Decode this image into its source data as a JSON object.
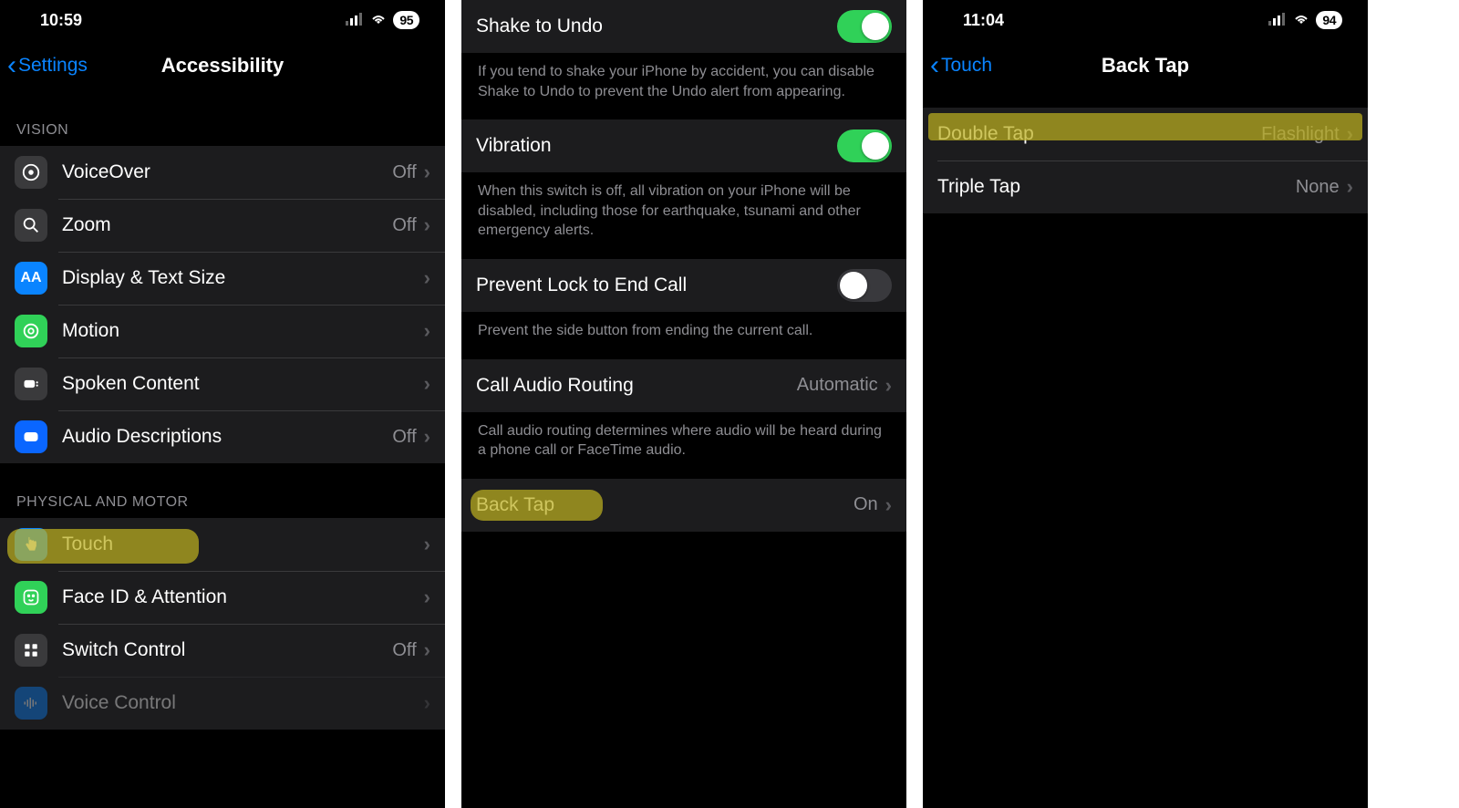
{
  "phone1": {
    "status": {
      "time": "10:59",
      "battery": "95"
    },
    "nav": {
      "back": "Settings",
      "title": "Accessibility"
    },
    "sections": {
      "vision": {
        "header": "VISION",
        "items": [
          {
            "label": "VoiceOver",
            "value": "Off"
          },
          {
            "label": "Zoom",
            "value": "Off"
          },
          {
            "label": "Display & Text Size",
            "value": ""
          },
          {
            "label": "Motion",
            "value": ""
          },
          {
            "label": "Spoken Content",
            "value": ""
          },
          {
            "label": "Audio Descriptions",
            "value": "Off"
          }
        ]
      },
      "physical": {
        "header": "PHYSICAL AND MOTOR",
        "items": [
          {
            "label": "Touch",
            "value": ""
          },
          {
            "label": "Face ID & Attention",
            "value": ""
          },
          {
            "label": "Switch Control",
            "value": "Off"
          },
          {
            "label": "Voice Control",
            "value": ""
          }
        ]
      }
    }
  },
  "phone2": {
    "rows": {
      "shake": {
        "label": "Shake to Undo",
        "footer": "If you tend to shake your iPhone by accident, you can disable Shake to Undo to prevent the Undo alert from appearing."
      },
      "vibration": {
        "label": "Vibration",
        "footer": "When this switch is off, all vibration on your iPhone will be disabled, including those for earthquake, tsunami and other emergency alerts."
      },
      "prevent": {
        "label": "Prevent Lock to End Call",
        "footer": "Prevent the side button from ending the current call."
      },
      "routing": {
        "label": "Call Audio Routing",
        "value": "Automatic",
        "footer": "Call audio routing determines where audio will be heard during a phone call or FaceTime audio."
      },
      "backtap": {
        "label": "Back Tap",
        "value": "On"
      }
    }
  },
  "phone3": {
    "status": {
      "time": "11:04",
      "battery": "94"
    },
    "nav": {
      "back": "Touch",
      "title": "Back Tap"
    },
    "items": [
      {
        "label": "Double Tap",
        "value": "Flashlight"
      },
      {
        "label": "Triple Tap",
        "value": "None"
      }
    ]
  }
}
